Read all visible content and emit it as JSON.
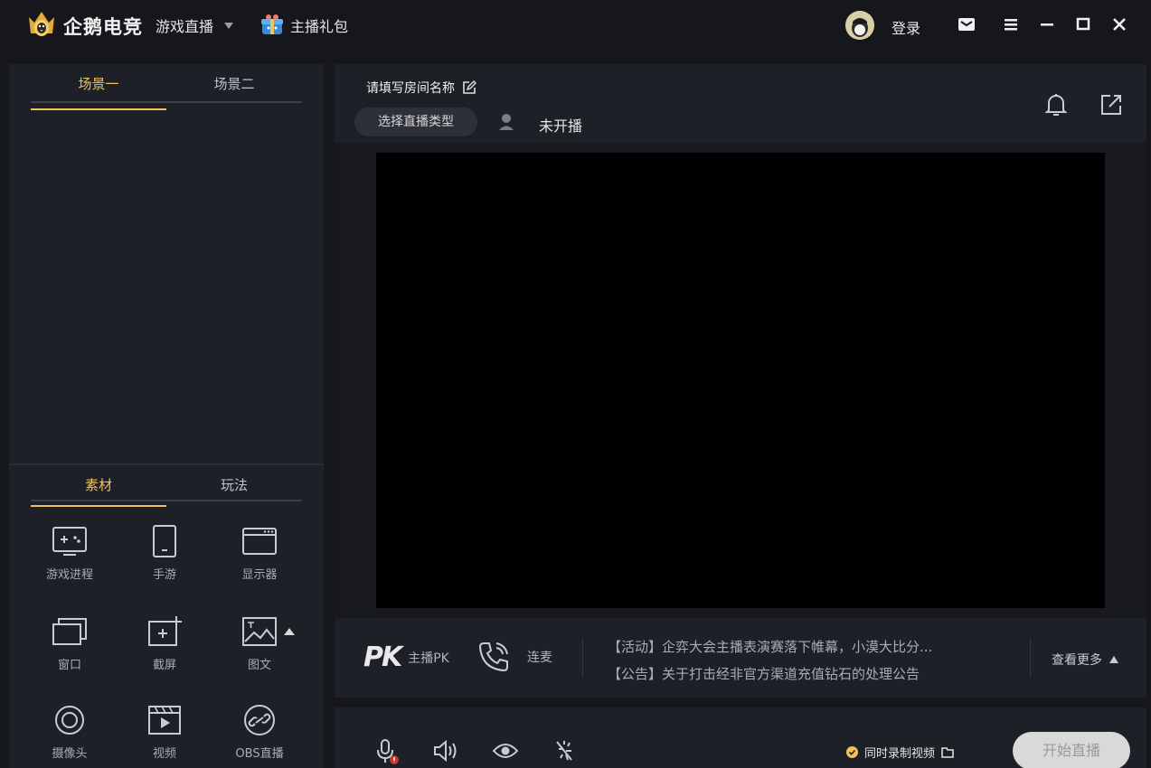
{
  "app": {
    "brand": "企鹅电竞",
    "nav_live": "游戏直播",
    "gift_label": "主播礼包",
    "login": "登录"
  },
  "left_panel": {
    "scene_tabs": [
      "场景一",
      "场景二"
    ],
    "material_tabs": [
      "素材",
      "玩法"
    ],
    "sources": [
      {
        "label": "游戏进程",
        "icon": "game-process-icon"
      },
      {
        "label": "手游",
        "icon": "mobile-game-icon"
      },
      {
        "label": "显示器",
        "icon": "monitor-icon"
      },
      {
        "label": "窗口",
        "icon": "window-icon"
      },
      {
        "label": "截屏",
        "icon": "screenshot-icon"
      },
      {
        "label": "图文",
        "icon": "image-text-icon"
      },
      {
        "label": "摄像头",
        "icon": "camera-icon"
      },
      {
        "label": "视频",
        "icon": "video-icon"
      },
      {
        "label": "OBS直播",
        "icon": "obs-link-icon"
      }
    ]
  },
  "room": {
    "name_placeholder": "请填写房间名称",
    "type_button": "选择直播类型",
    "status": "未开播"
  },
  "infobar": {
    "pk_mark": "PK",
    "pk_label": "主播PK",
    "lianmai_label": "连麦",
    "notices": [
      "【活动】企弈大会主播表演赛落下帷幕，小漠大比分...",
      "【公告】关于打击经非官方渠道充值钻石的处理公告"
    ],
    "more": "查看更多"
  },
  "controls": {
    "record_label": "同时录制视频",
    "start_button": "开始直播"
  },
  "colors": {
    "accent": "#f2c25a",
    "panel": "#1e2027",
    "background": "#15171c"
  }
}
